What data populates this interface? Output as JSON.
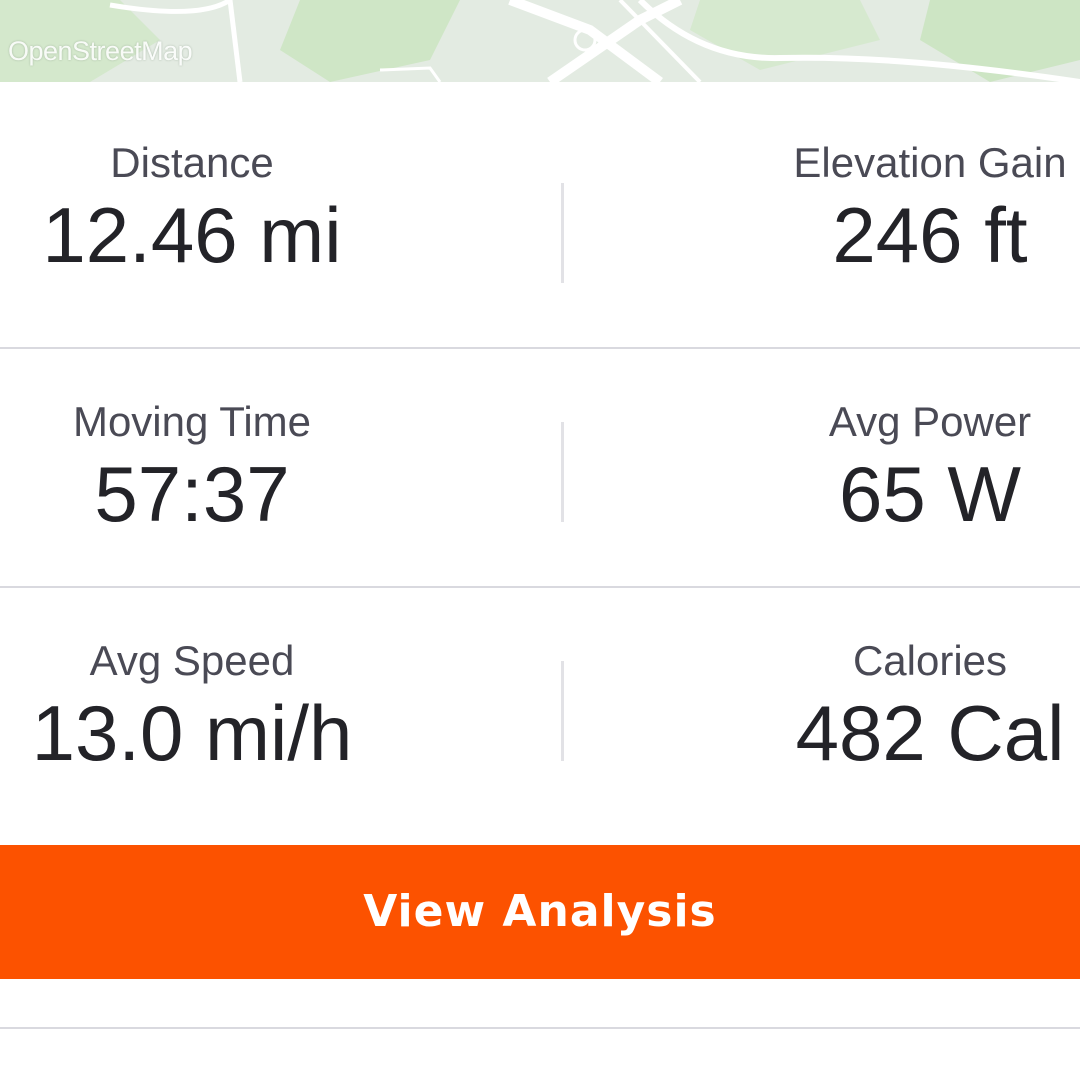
{
  "map": {
    "attribution": "OpenStreetMap",
    "colors": {
      "land": "#e3ebe2",
      "green": "#c9e4c0",
      "road": "#ffffff"
    }
  },
  "stats": {
    "rows": [
      {
        "left": {
          "label": "Distance",
          "value": "12.46 mi"
        },
        "right": {
          "label": "Elevation Gain",
          "value": "246 ft"
        }
      },
      {
        "left": {
          "label": "Moving Time",
          "value": "57:37"
        },
        "right": {
          "label": "Avg Power",
          "value": "65 W"
        }
      },
      {
        "left": {
          "label": "Avg Speed",
          "value": "13.0 mi/h"
        },
        "right": {
          "label": "Calories",
          "value": "482 Cal"
        }
      }
    ]
  },
  "actions": {
    "view_analysis_label": "View Analysis"
  },
  "colors": {
    "accent": "#fc5200",
    "text_primary": "#232328",
    "text_secondary": "#4a4a55",
    "divider": "#d9d9df"
  }
}
